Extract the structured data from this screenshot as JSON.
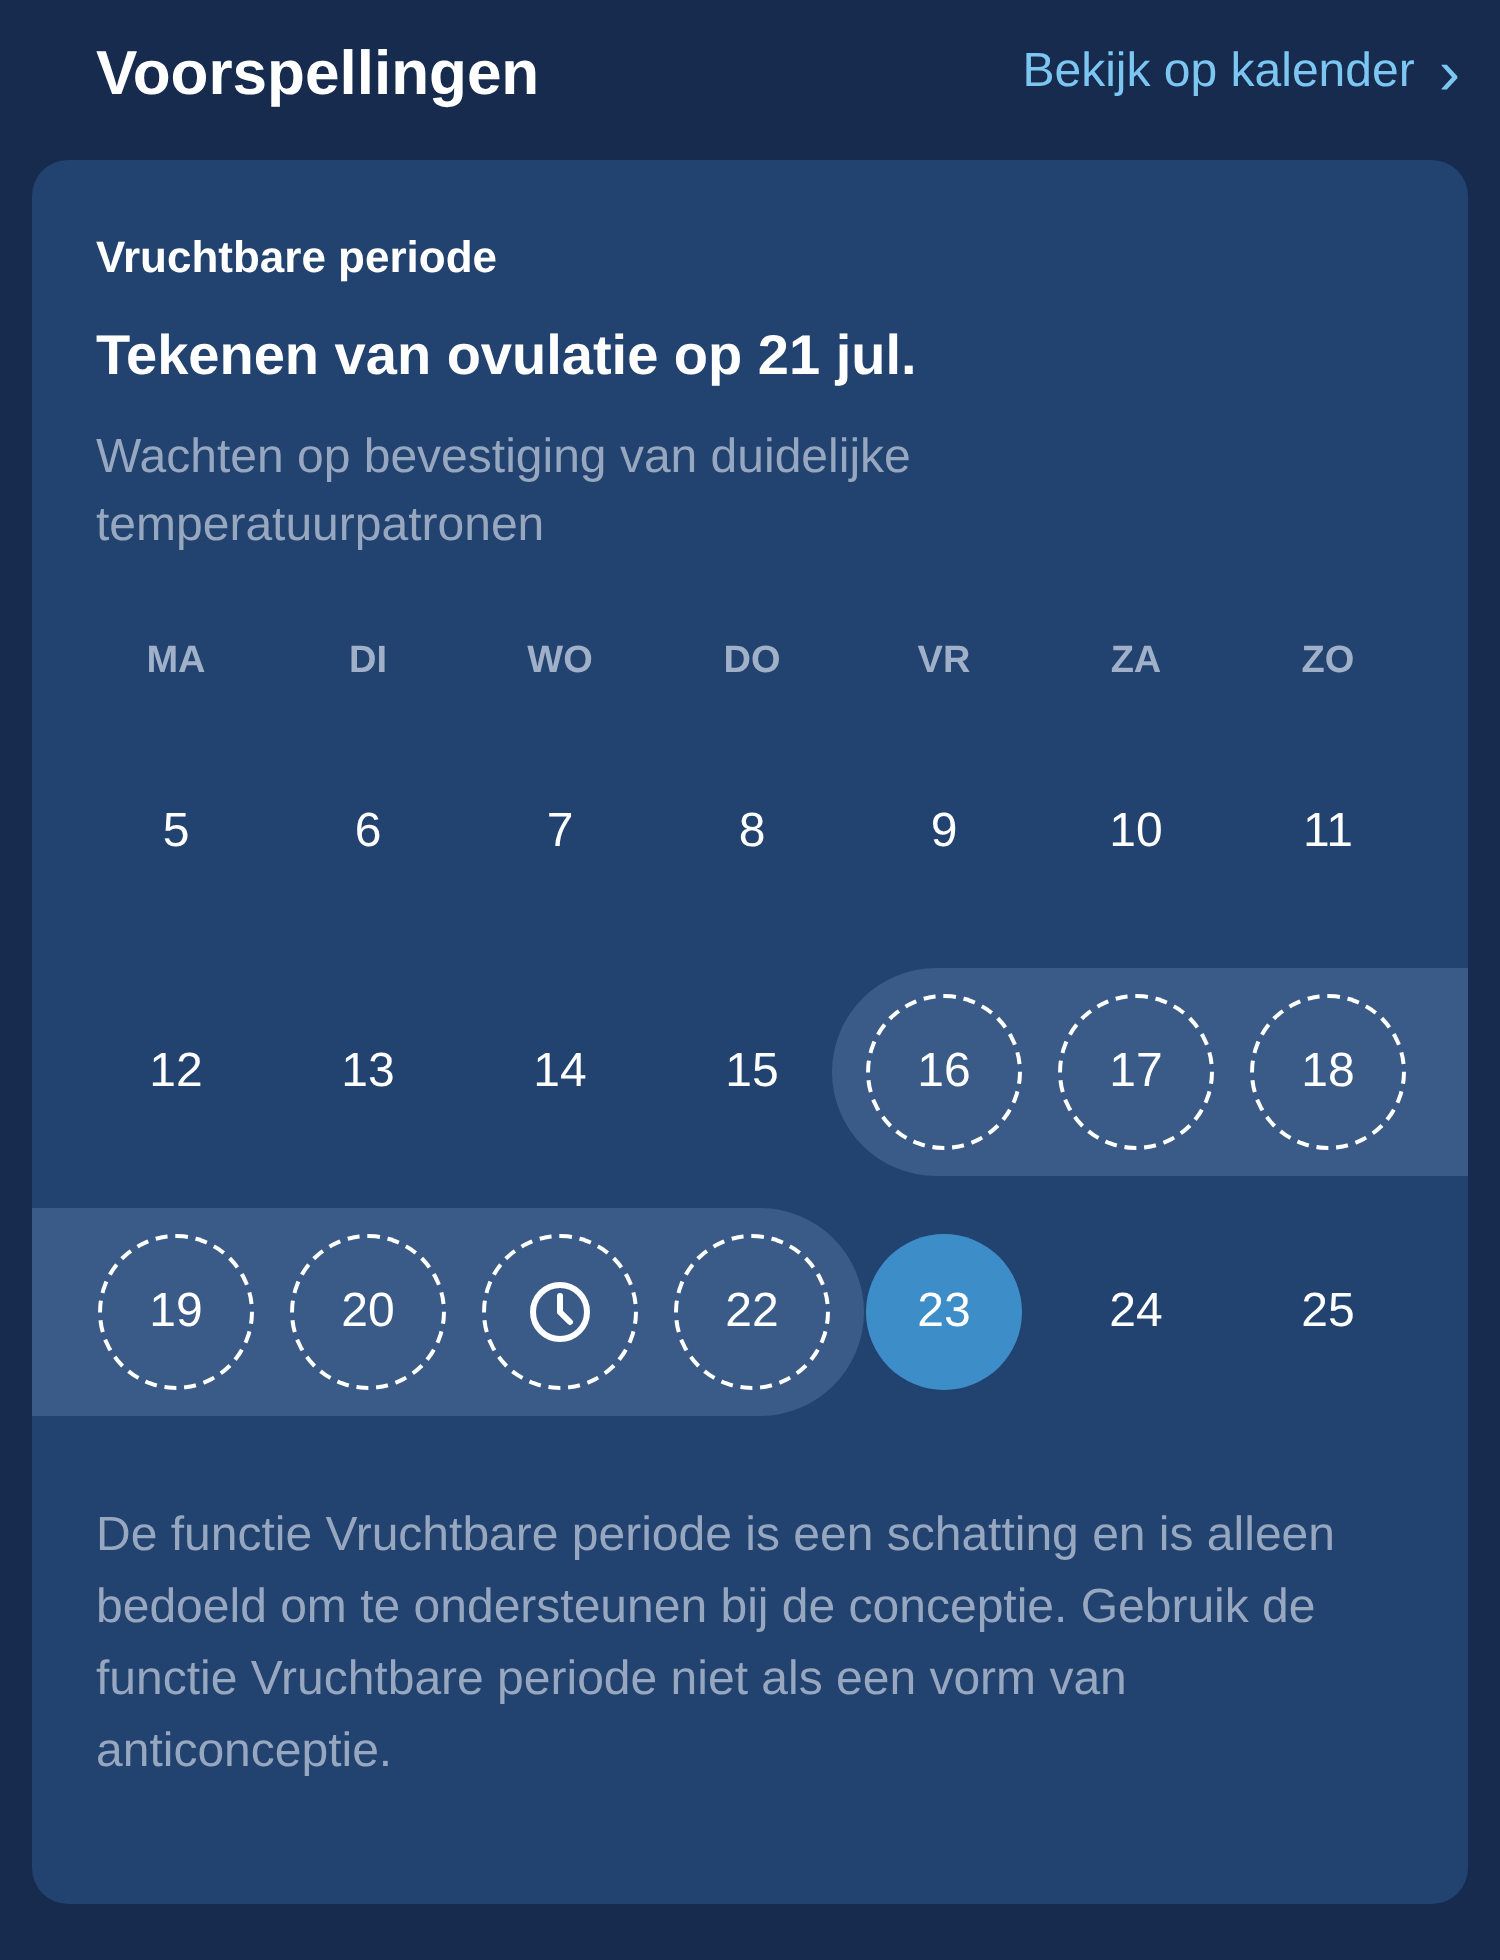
{
  "header": {
    "title": "Voorspellingen",
    "link": "Bekijk op kalender",
    "link_chevron": "›"
  },
  "card": {
    "label": "Vruchtbare periode",
    "title": "Tekenen van ovulatie op 21 jul.",
    "subtitle": "Wachten op bevestiging van duidelijke temperatuurpatronen",
    "weekdays": [
      "MA",
      "DI",
      "WO",
      "DO",
      "VR",
      "ZA",
      "ZO"
    ],
    "weeks": [
      [
        {
          "label": "5",
          "kind": "number",
          "fertile": false,
          "today": false
        },
        {
          "label": "6",
          "kind": "number",
          "fertile": false,
          "today": false
        },
        {
          "label": "7",
          "kind": "number",
          "fertile": false,
          "today": false
        },
        {
          "label": "8",
          "kind": "number",
          "fertile": false,
          "today": false
        },
        {
          "label": "9",
          "kind": "number",
          "fertile": false,
          "today": false
        },
        {
          "label": "10",
          "kind": "number",
          "fertile": false,
          "today": false
        },
        {
          "label": "11",
          "kind": "number",
          "fertile": false,
          "today": false
        }
      ],
      [
        {
          "label": "12",
          "kind": "number",
          "fertile": false,
          "today": false
        },
        {
          "label": "13",
          "kind": "number",
          "fertile": false,
          "today": false
        },
        {
          "label": "14",
          "kind": "number",
          "fertile": false,
          "today": false
        },
        {
          "label": "15",
          "kind": "number",
          "fertile": false,
          "today": false
        },
        {
          "label": "16",
          "kind": "number",
          "fertile": true,
          "today": false
        },
        {
          "label": "17",
          "kind": "number",
          "fertile": true,
          "today": false
        },
        {
          "label": "18",
          "kind": "number",
          "fertile": true,
          "today": false
        }
      ],
      [
        {
          "label": "19",
          "kind": "number",
          "fertile": true,
          "today": false
        },
        {
          "label": "20",
          "kind": "number",
          "fertile": true,
          "today": false
        },
        {
          "kind": "clock",
          "fertile": true,
          "today": false
        },
        {
          "label": "22",
          "kind": "number",
          "fertile": true,
          "today": false
        },
        {
          "label": "23",
          "kind": "number",
          "fertile": false,
          "today": true
        },
        {
          "label": "24",
          "kind": "number",
          "fertile": false,
          "today": false
        },
        {
          "label": "25",
          "kind": "number",
          "fertile": false,
          "today": false
        }
      ]
    ],
    "disclaimer": "De functie Vruchtbare periode is een schatting en is alleen bedoeld om te ondersteunen bij de conceptie. Gebruik de functie Vruchtbare periode niet als een vorm van anticonceptie."
  }
}
